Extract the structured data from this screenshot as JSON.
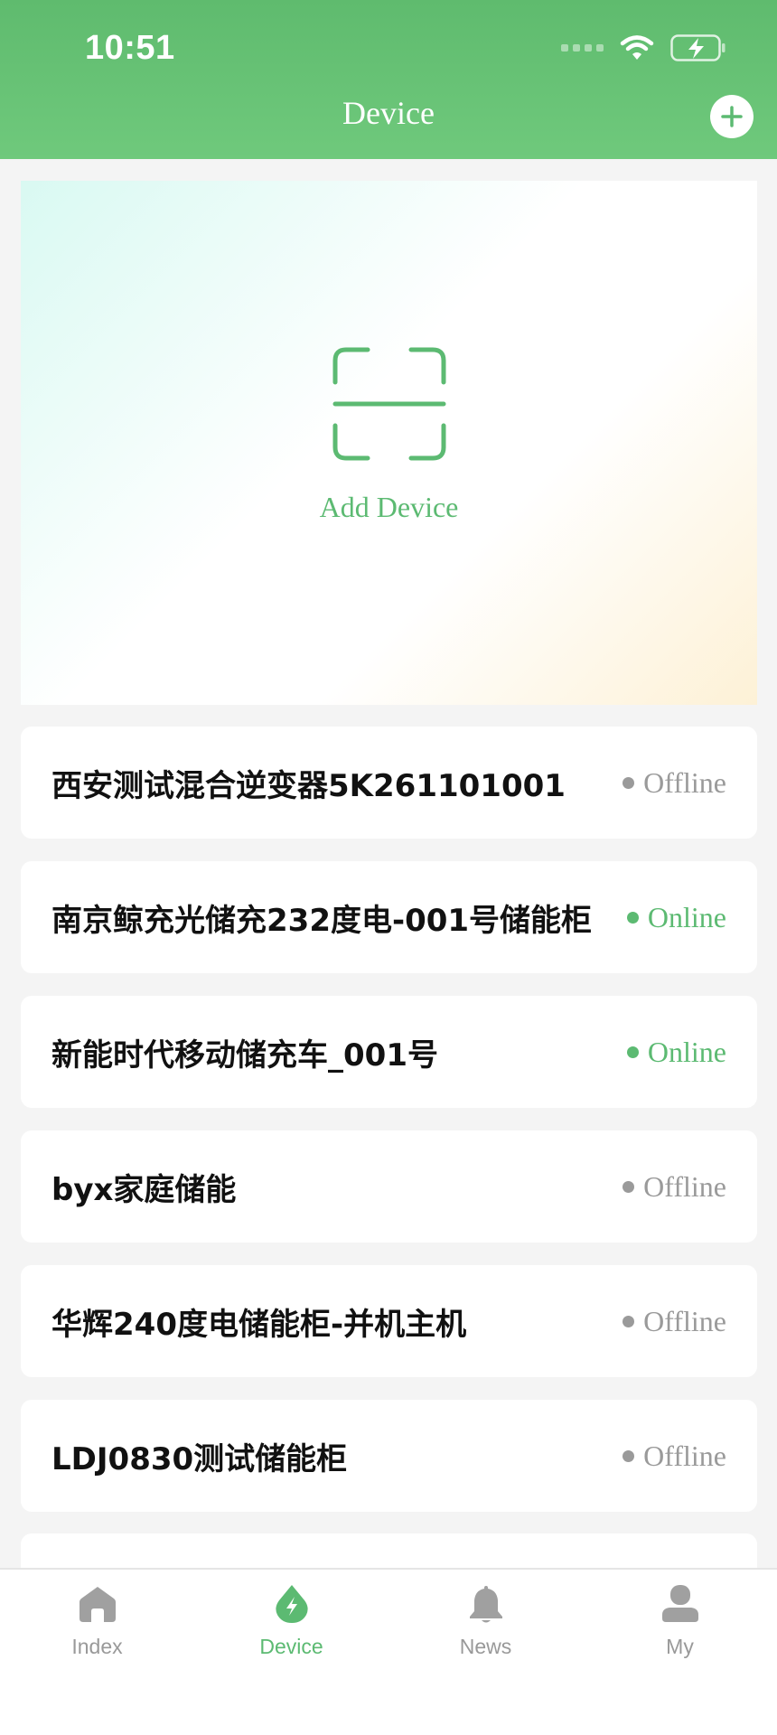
{
  "status_bar": {
    "time": "10:51"
  },
  "header": {
    "title": "Device"
  },
  "add_card": {
    "label": "Add Device"
  },
  "devices": [
    {
      "name": "西安测试混合逆变器5K261101001",
      "status": "Offline"
    },
    {
      "name": "南京鲸充光储充232度电-001号储能柜",
      "status": "Online"
    },
    {
      "name": "新能时代移动储充车_001号",
      "status": "Online"
    },
    {
      "name": "byx家庭储能",
      "status": "Offline"
    },
    {
      "name": "华辉240度电储能柜-并机主机",
      "status": "Offline"
    },
    {
      "name": "LDJ0830测试储能柜",
      "status": "Offline"
    }
  ],
  "tabs": [
    {
      "label": "Index",
      "icon": "home-icon"
    },
    {
      "label": "Device",
      "icon": "device-bolt-icon"
    },
    {
      "label": "News",
      "icon": "bell-icon"
    },
    {
      "label": "My",
      "icon": "user-icon"
    }
  ],
  "colors": {
    "brand_green": "#5cba72",
    "header_green": "#66c274",
    "offline_gray": "#9a9a9a"
  }
}
